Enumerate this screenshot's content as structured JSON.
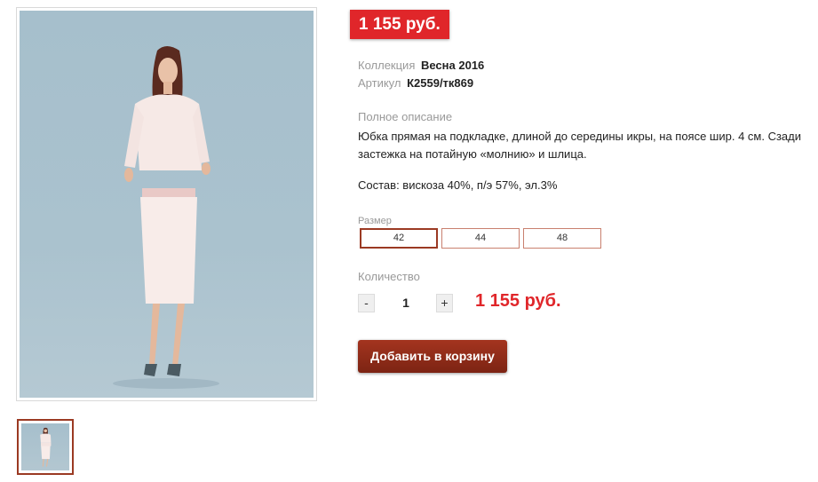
{
  "product": {
    "price_badge": "1 155 руб.",
    "collection_label": "Коллекция",
    "collection_value": "Весна 2016",
    "article_label": "Артикул",
    "article_value": "К2559/тк869",
    "description_label": "Полное описание",
    "description_text": "Юбка прямая на подкладке, длиной до середины икры, на поясе шир. 4 см. Сзади застежка на потайную «молнию» и шлица.",
    "composition": "Состав: вискоза 40%, п/э 57%, эл.3%"
  },
  "size_selector": {
    "label": "Размер",
    "options": [
      "42",
      "44",
      "48"
    ],
    "selected": "42"
  },
  "quantity": {
    "label": "Количество",
    "minus": "-",
    "value": "1",
    "plus": "+",
    "total": "1 155 руб."
  },
  "cart": {
    "add_label": "Добавить в корзину"
  },
  "colors": {
    "price_red": "#e0262a",
    "brand_brown": "#9b3a23",
    "photo_bg": "#a6bfcc"
  }
}
